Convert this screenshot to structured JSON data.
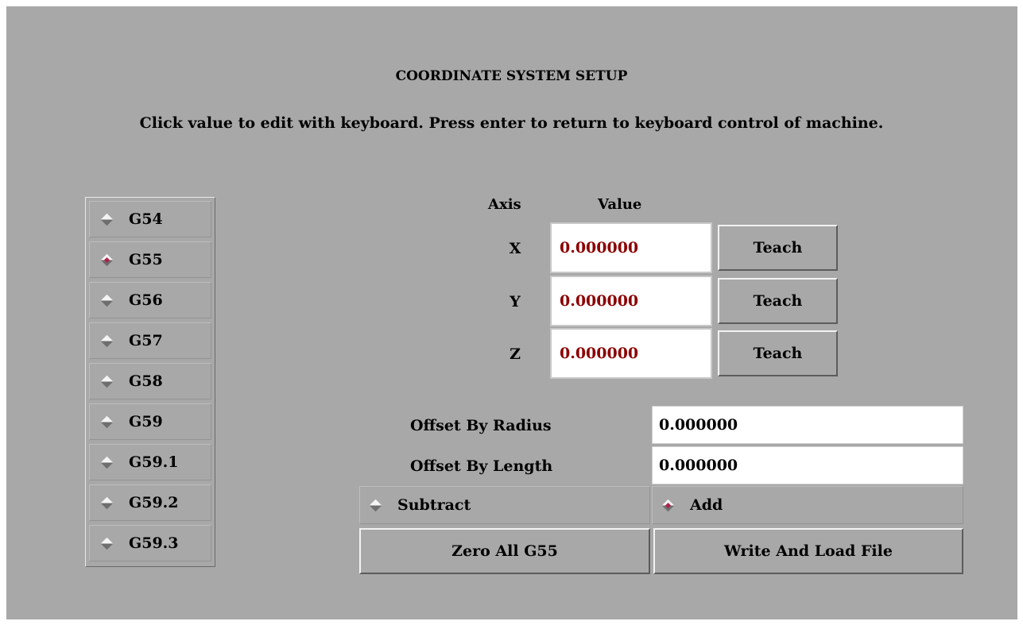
{
  "title": "COORDINATE SYSTEM SETUP",
  "instruction": "Click value to edit with keyboard.  Press enter to return to keyboard control of machine.",
  "coordinate_systems": {
    "selected": "G55",
    "items": [
      "G54",
      "G55",
      "G56",
      "G57",
      "G58",
      "G59",
      "G59.1",
      "G59.2",
      "G59.3"
    ]
  },
  "axes_table": {
    "axis_header": "Axis",
    "value_header": "Value",
    "rows": [
      {
        "axis": "X",
        "value": "0.000000",
        "button": "Teach"
      },
      {
        "axis": "Y",
        "value": "0.000000",
        "button": "Teach"
      },
      {
        "axis": "Z",
        "value": "0.000000",
        "button": "Teach"
      }
    ]
  },
  "offsets": {
    "radius_label": "Offset By Radius",
    "radius_value": "0.000000",
    "length_label": "Offset By Length",
    "length_value": "0.000000"
  },
  "offset_mode": {
    "subtract_label": "Subtract",
    "add_label": "Add",
    "selected": "Add"
  },
  "buttons": {
    "zero_all": "Zero All G55",
    "write_load": "Write And Load File"
  },
  "colors": {
    "panel_bg": "#a8a8a8",
    "value_text": "#8b0000",
    "radio_selected": "#b0204a"
  }
}
